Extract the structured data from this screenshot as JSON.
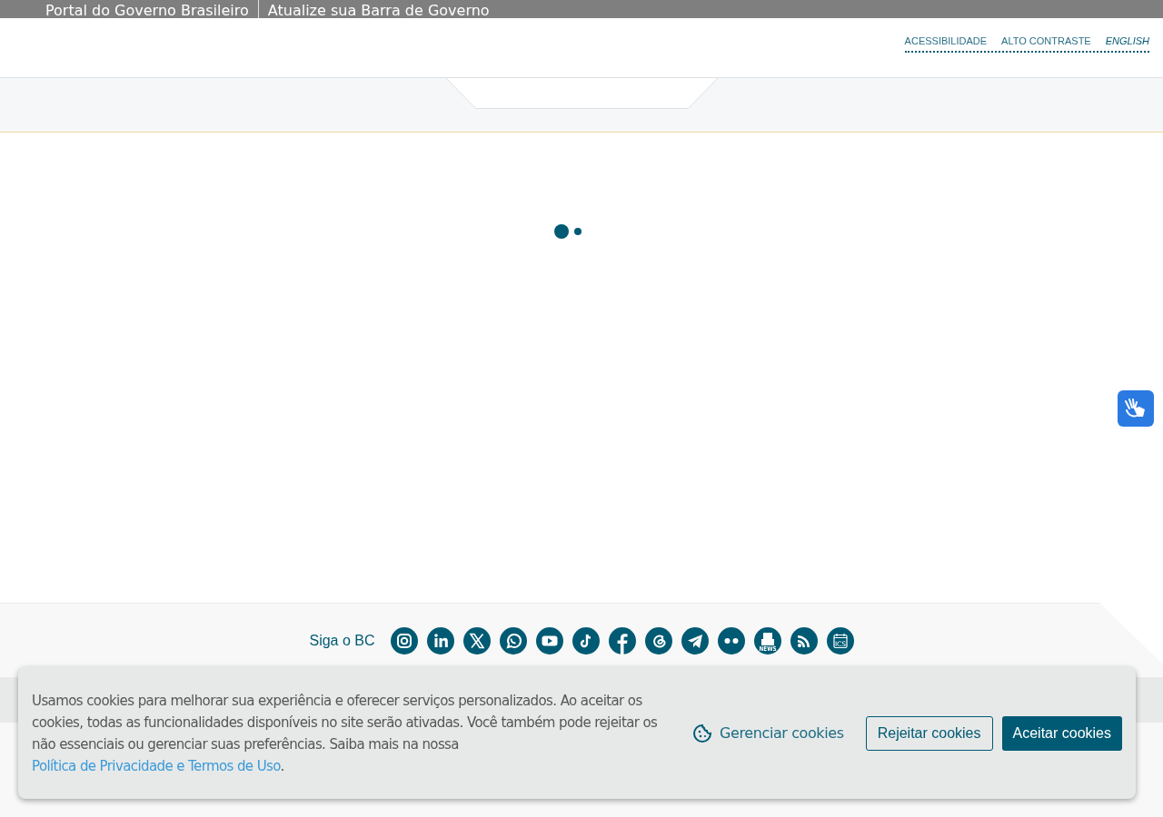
{
  "gov_bar": {
    "links": [
      "Portal do Governo Brasileiro",
      "Atualize sua Barra de Governo"
    ]
  },
  "header": {
    "links": [
      {
        "label": "ACESSIBILIDADE",
        "italic": false
      },
      {
        "label": "ALTO CONTRASTE",
        "italic": false
      },
      {
        "label": "ENGLISH",
        "italic": true
      }
    ]
  },
  "footer": {
    "follow_label": "Siga o BC",
    "social": [
      {
        "kind": "instagram"
      },
      {
        "kind": "linkedin"
      },
      {
        "kind": "x"
      },
      {
        "kind": "whatsapp"
      },
      {
        "kind": "youtube"
      },
      {
        "kind": "tiktok"
      },
      {
        "kind": "facebook"
      },
      {
        "kind": "threads"
      },
      {
        "kind": "telegram"
      },
      {
        "kind": "flickr"
      },
      {
        "kind": "news",
        "label": "NEWS"
      },
      {
        "kind": "rss"
      },
      {
        "kind": "calendar",
        "label": "ICS"
      }
    ]
  },
  "cookie_banner": {
    "text": "Usamos cookies para melhorar sua experiência e oferecer serviços personalizados. Ao aceitar os cookies, todas as funcionalidades disponíveis no site serão ativadas. Você também pode rejeitar os não essenciais ou gerenciar suas preferências. Saiba mais na nossa ",
    "link": "Política de Privacidade e Termos de Uso",
    "after": ".",
    "manage": "Gerenciar cookies",
    "reject": "Rejeitar cookies",
    "accept": "Aceitar cookies"
  }
}
